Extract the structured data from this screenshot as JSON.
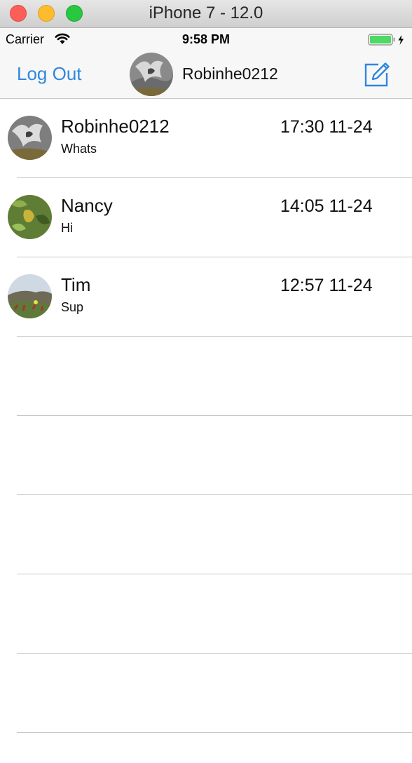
{
  "window": {
    "title": "iPhone 7 - 12.0"
  },
  "status_bar": {
    "carrier": "Carrier",
    "time": "9:58 PM"
  },
  "nav": {
    "left_label": "Log Out",
    "username": "Robinhe0212"
  },
  "conversations": [
    {
      "name": "Robinhe0212",
      "message": "Whats",
      "time": "17:30 11-24"
    },
    {
      "name": "Nancy",
      "message": "Hi",
      "time": "14:05 11-24"
    },
    {
      "name": "Tim",
      "message": "Sup",
      "time": "12:57 11-24"
    }
  ],
  "colors": {
    "accent": "#2f87df",
    "separator": "#c8c7cc",
    "battery": "#4cd964"
  }
}
